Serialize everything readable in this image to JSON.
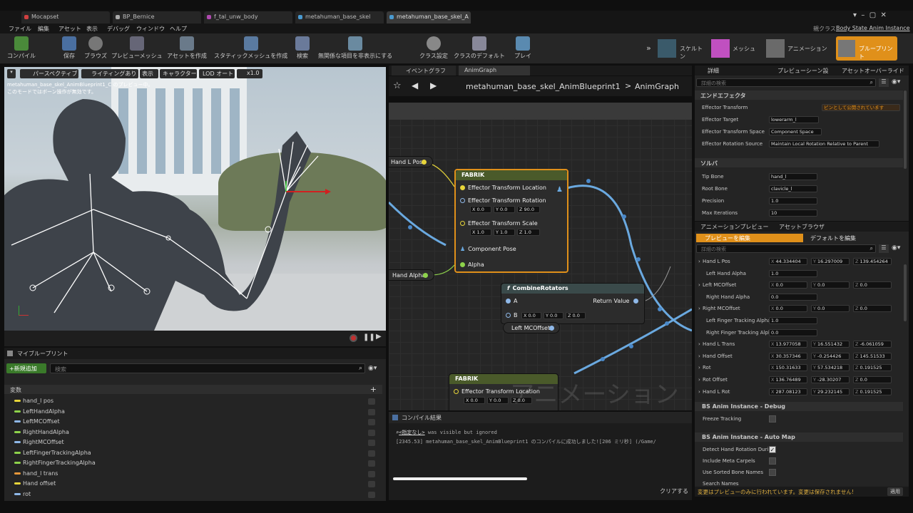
{
  "window": {
    "tabs": [
      "Mocapset",
      "BP_Bernice",
      "f_tal_unw_body",
      "metahuman_base_skel",
      "metahuman_base_skel_A"
    ],
    "parent_class_label": "親クラス",
    "parent_class": "Body State Anim Instance"
  },
  "menu": [
    "ファイル",
    "編集",
    "アセット",
    "表示",
    "デバッグ",
    "ウィンドウ",
    "ヘルプ"
  ],
  "toolbar": {
    "compile": "コンパイル",
    "save": "保存",
    "browse": "ブラウズ",
    "preview_mesh": "プレビューメッシュ",
    "create_asset": "アセットを作成",
    "static_mesh": "スタティックメッシュを作成",
    "search": "検索",
    "hide_unused": "無関係な項目を非表示にする",
    "class_settings": "クラス設定",
    "class_defaults": "クラスのデフォルト",
    "play": "プレイ",
    "skeleton": "スケルトン",
    "mesh": "メッシュ",
    "animation": "アニメーション",
    "blueprint": "ブループリント"
  },
  "viewport": {
    "buttons": [
      "パースペクティブ",
      "ライティングあり",
      "表示",
      "キャラクター",
      "LOD オート",
      "x1.0"
    ],
    "info_line1": "metahuman_base_skel_AnimBlueprint1_C のプレビュー中。",
    "info_line2": "このモードではボーン操作が無効です。"
  },
  "myblueprint": {
    "title": "マイブループリント",
    "add_new": "+新規追加",
    "search_placeholder": "検索",
    "section": "変数",
    "variables": [
      {
        "name": "hand_l pos",
        "color": "#e7d53a"
      },
      {
        "name": "LeftHandAlpha",
        "color": "#8ed34b"
      },
      {
        "name": "LeftMCOffset",
        "color": "#8fb8e8"
      },
      {
        "name": "RightHandAlpha",
        "color": "#8ed34b"
      },
      {
        "name": "RightMCOffset",
        "color": "#8fb8e8"
      },
      {
        "name": "LeftFingerTrackingAlpha",
        "color": "#8ed34b"
      },
      {
        "name": "RightFingerTrackingAlpha",
        "color": "#8ed34b"
      },
      {
        "name": "hand_l trans",
        "color": "#e7983a"
      },
      {
        "name": "Hand offset",
        "color": "#e7d53a"
      },
      {
        "name": "rot",
        "color": "#8fb8e8"
      }
    ]
  },
  "graph": {
    "tabs": [
      "イベントグラフ",
      "AnimGraph"
    ],
    "breadcrumb_bp": "metahuman_base_skel_AnimBlueprint1",
    "breadcrumb_graph": "AnimGraph",
    "watermark": "アニメーション",
    "fabrik1": {
      "title": "FABRIK",
      "pins": [
        "Effector Transform Location",
        "Effector Transform Rotation",
        "Effector Transform Scale",
        "Component Pose",
        "Alpha"
      ],
      "rot": {
        "x": "0.0",
        "y": "0.0",
        "z": "90.0"
      },
      "scale": {
        "x": "1.0",
        "y": "1.0",
        "z": "1.0"
      }
    },
    "hand_l_pos": "Hand L Pos",
    "hand_alpha": "Hand Alpha",
    "combine": {
      "title": "CombineRotators",
      "a": "A",
      "b": "B",
      "ret": "Return Value",
      "b_vals": {
        "x": "0.0",
        "y": "0.0",
        "z": "0.0"
      }
    },
    "left_mc": "Left MCOffset",
    "fabrik2": {
      "title": "FABRIK",
      "pin": "Effector Transform Location",
      "vals": {
        "x": "0.0",
        "y": "0.0",
        "z": "0.0"
      }
    }
  },
  "compile": {
    "title": "コンパイル結果",
    "line1_tag": "<指定なし>",
    "line1": " was visible but ignored",
    "line2": "[2345.53] metahuman_base_skel_AnimBlueprint1 のコンパイルに成功しました![206 ミリ秒] (/Game/",
    "clear": "クリアする"
  },
  "details": {
    "tabs": [
      "詳細",
      "プレビューシーン設",
      "アセットオーバーライド"
    ],
    "search_placeholder": "詳細の検索",
    "end_effector": {
      "title": "エンドエフェクタ",
      "rows": [
        {
          "label": "Effector Transform",
          "value": "ピンとして公開されています"
        },
        {
          "label": "Effector Target",
          "value": "lowerarm_l"
        },
        {
          "label": "Effector Transform Space",
          "value": "Component Space"
        },
        {
          "label": "Effector Rotation Source",
          "value": "Maintain Local Rotation Relative to Parent"
        }
      ]
    },
    "solver": {
      "title": "ソルバ",
      "rows": [
        {
          "label": "Tip Bone",
          "value": "hand_l"
        },
        {
          "label": "Root Bone",
          "value": "clavicle_l"
        },
        {
          "label": "Precision",
          "value": "1.0"
        },
        {
          "label": "Max Iterations",
          "value": "10"
        }
      ]
    }
  },
  "anim_preview": {
    "tabs": [
      "アニメーションプレビュー",
      "アセットブラウザ"
    ],
    "edit_preview": "プレビューを編集",
    "edit_defaults": "デフォルトを編集",
    "search_placeholder": "詳細の検索",
    "rows": [
      {
        "label": "Hand L Pos",
        "x": "44.334404",
        "y": "16.297009",
        "z": "139.454264"
      },
      {
        "label": "Left Hand Alpha",
        "v": "1.0"
      },
      {
        "label": "Left MCOffset",
        "x": "0.0",
        "y": "0.0",
        "z": "0.0"
      },
      {
        "label": "Right Hand Alpha",
        "v": "0.0"
      },
      {
        "label": "Right MCOffset",
        "x": "0.0",
        "y": "0.0",
        "z": "0.0"
      },
      {
        "label": "Left Finger Tracking Alpha",
        "v": "1.0"
      },
      {
        "label": "Right Finger Tracking Alpha",
        "v": "0.0"
      },
      {
        "label": "Hand L Trans",
        "x": "13.977058",
        "y": "16.551432",
        "z": "-6.061059"
      },
      {
        "label": "Hand Offset",
        "x": "30.357346",
        "y": "-0.254426",
        "z": "145.51533"
      },
      {
        "label": "Rot",
        "x": "150.31633",
        "y": "57.534218",
        "z": "0.191525"
      },
      {
        "label": "Rot Offset",
        "x": "136.76489",
        "y": "-28.30207",
        "z": "0.0"
      },
      {
        "label": "Hand L Rot",
        "x": "287.08123",
        "y": "29.232145",
        "z": "0.191525"
      }
    ],
    "debug_title": "BS Anim Instance - Debug",
    "freeze": "Freeze Tracking",
    "automap_title": "BS Anim Instance - Auto Map",
    "detect": "Detect Hand Rotation Durin",
    "meta": "Include Meta Carpels",
    "sorted": "Use Sorted Bone Names",
    "search_names": "Search Names"
  },
  "status": {
    "text": "変更はプレビューのみに行われています。変更は保存されません!",
    "apply": "適用"
  }
}
